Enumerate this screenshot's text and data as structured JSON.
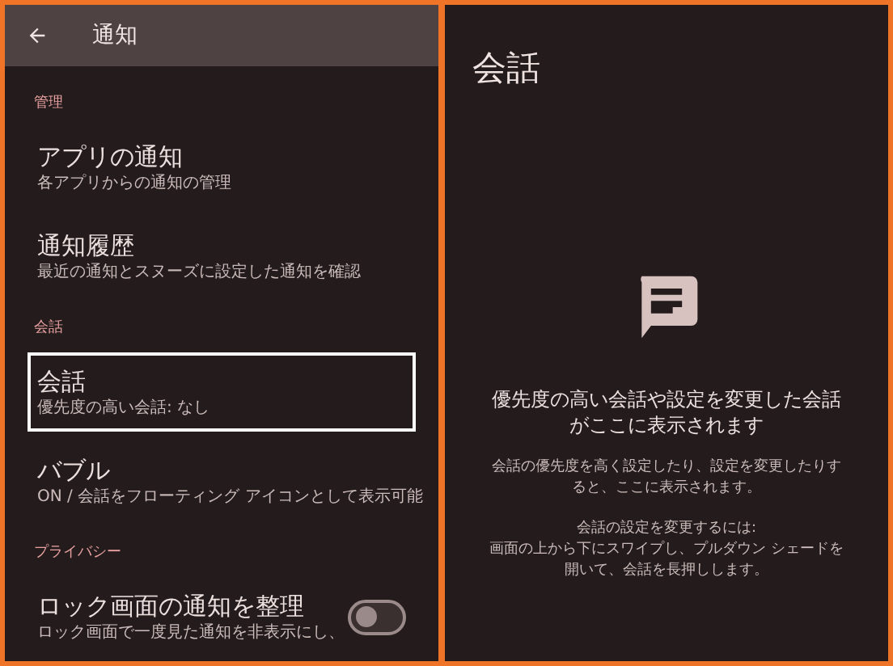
{
  "header": {
    "title": "通知"
  },
  "sections": [
    {
      "heading": "管理",
      "items": [
        {
          "title": "アプリの通知",
          "subtitle": [
            "各アプリからの通知の管理"
          ],
          "kind": "link",
          "focused": false
        },
        {
          "title": "通知履歴",
          "subtitle": [
            "最近の通知とスヌーズに設定した通知を確認"
          ],
          "kind": "link",
          "focused": false
        }
      ]
    },
    {
      "heading": "会話",
      "items": [
        {
          "title": "会話",
          "subtitle": [
            "優先度の高い会話: なし"
          ],
          "kind": "link",
          "focused": true
        },
        {
          "title": "バブル",
          "subtitle": [
            "ON / 会話をフローティング アイコンとして表示可能"
          ],
          "kind": "link",
          "focused": false
        }
      ]
    },
    {
      "heading": "プライバシー",
      "items": [
        {
          "title": "ロック画面の通知を整理",
          "subtitle": [
            "ロック画面で一度見た通知を非表示にし、"
          ],
          "kind": "toggle",
          "on": false,
          "focused": false
        }
      ]
    }
  ],
  "detail": {
    "title": "会話",
    "empty_title": "優先度の高い会話や設定を変更した会話がここに表示されます",
    "paragraphs": [
      "会話の優先度を高く設定したり、設定を変更したりすると、ここに表示されます。",
      "会話の設定を変更するには:\n画面の上から下にスワイプし、プルダウン シェードを開いて、会話を長押しします。"
    ]
  }
}
